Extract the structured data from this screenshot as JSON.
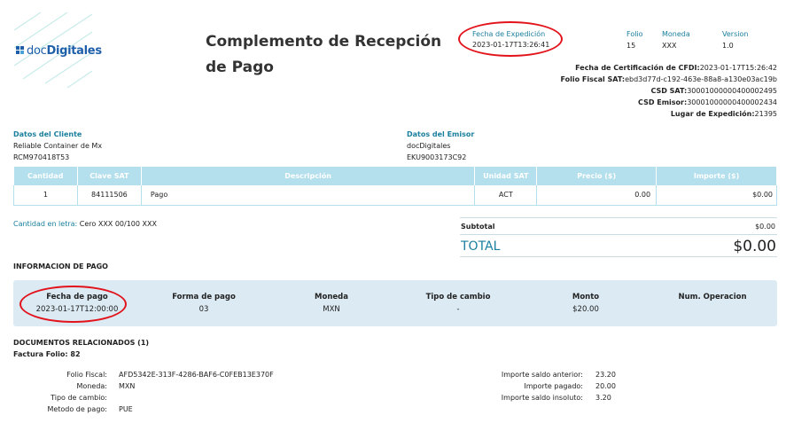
{
  "logo": {
    "prefix": "doc",
    "brand": "Digitales",
    "icon": "logo-squares-icon"
  },
  "title": "Complemento de Recepción de Pago",
  "expedicion": {
    "label": "Fecha de Expedición",
    "value": "2023-01-17T13:26:41"
  },
  "meta_cols": [
    {
      "label": "Folio",
      "value": "15"
    },
    {
      "label": "Moneda",
      "value": "XXX"
    },
    {
      "label": "Version",
      "value": "1.0"
    }
  ],
  "cert": [
    {
      "label": "Fecha de Certificación de CFDI:",
      "value": "2023-01-17T15:26:42"
    },
    {
      "label": "Folio Fiscal SAT:",
      "value": "ebd3d77d-c192-463e-88a8-a130e03ac19b"
    },
    {
      "label": "CSD SAT:",
      "value": "30001000000400002495"
    },
    {
      "label": "CSD Emisor:",
      "value": "30001000000400002434"
    },
    {
      "label": "Lugar de Expedición:",
      "value": "21395"
    }
  ],
  "cliente": {
    "label": "Datos del Cliente",
    "name": "Reliable Container de Mx",
    "rfc": "RCM970418T53"
  },
  "emisor": {
    "label": "Datos del Emisor",
    "name": "docDigitales",
    "rfc": "EKU9003173C92"
  },
  "items_table": {
    "headers": [
      "Cantidad",
      "Clave SAT",
      "Descripción",
      "Unidad SAT",
      "Precio ($)",
      "Importe ($)"
    ],
    "rows": [
      [
        "1",
        "84111506",
        "Pago",
        "ACT",
        "0.00",
        "$0.00"
      ]
    ]
  },
  "cantidad_letra": {
    "label": "Cantidad en letra:",
    "value": "Cero XXX 00/100 XXX"
  },
  "totals": {
    "subtotal_label": "Subtotal",
    "subtotal_value": "$0.00",
    "total_label": "TOTAL",
    "total_value": "$0.00"
  },
  "info_pago": {
    "heading": "INFORMACION DE PAGO",
    "cols": [
      {
        "label": "Fecha de pago",
        "value": "2023-01-17T12:00:00"
      },
      {
        "label": "Forma de pago",
        "value": "03"
      },
      {
        "label": "Moneda",
        "value": "MXN"
      },
      {
        "label": "Tipo de cambio",
        "value": "-"
      },
      {
        "label": "Monto",
        "value": "$20.00"
      },
      {
        "label": "Num. Operacion",
        "value": ""
      }
    ]
  },
  "docs": {
    "heading": "DOCUMENTOS RELACIONADOS (1)",
    "factura": "Factura Folio: 82",
    "left": [
      {
        "label": "Folio Fiscal:",
        "value": "AFD5342E-313F-4286-BAF6-C0FEB13E370F"
      },
      {
        "label": "Moneda:",
        "value": "MXN"
      },
      {
        "label": "Tipo de cambio:",
        "value": ""
      },
      {
        "label": "Metodo de pago:",
        "value": "PUE"
      }
    ],
    "right": [
      {
        "label": "Importe saldo anterior:",
        "value": "23.20"
      },
      {
        "label": "Importe pagado:",
        "value": "20.00"
      },
      {
        "label": "Importe saldo insoluto:",
        "value": "3.20"
      }
    ]
  },
  "colors": {
    "accent": "#1a7f9e",
    "header_bg": "#b4dfec",
    "panel_bg": "#dbeaf3",
    "highlight_ellipse": "#e3131b"
  }
}
